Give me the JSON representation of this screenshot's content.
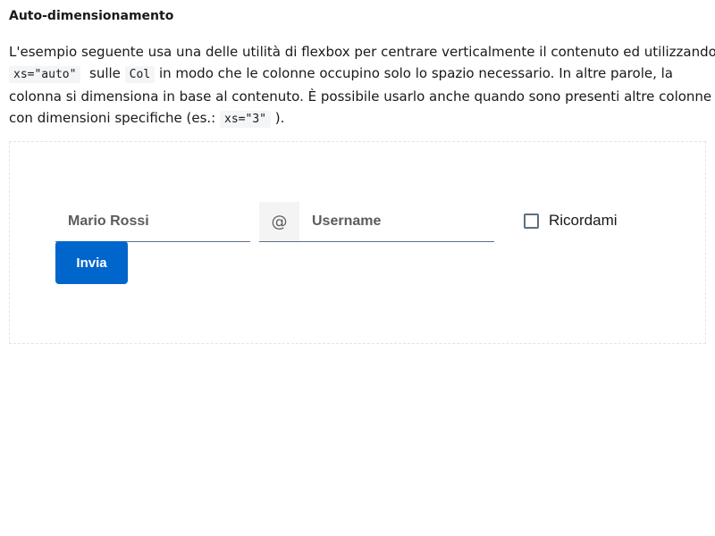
{
  "section": {
    "title": "Auto-dimensionamento"
  },
  "description": {
    "line1": "L'esempio seguente usa una delle utilità di flexbox per centrare verticalmente il contenuto ed utilizzando",
    "line2_code1": "xs=\"auto\"",
    "line2_text1": "sulle",
    "line2_code2": "Col",
    "line2_text2": "in modo che le colonne occupino solo lo spazio necessario. In altre parole, la",
    "line3": "colonna si dimensiona in base al contenuto. È possibile usarlo anche quando sono presenti altre colonne",
    "line4_text1": "con dimensioni specifiche (es.:",
    "line4_code": "xs=\"3\"",
    "line4_text2": ")."
  },
  "form": {
    "name_placeholder": "Mario Rossi",
    "prepend_symbol": "@",
    "username_placeholder": "Username",
    "checkbox_label": "Ricordami",
    "checkbox_checked": false,
    "submit_label": "Invia"
  },
  "colors": {
    "primary": "#0066cc",
    "input_border": "#5c6f82"
  }
}
